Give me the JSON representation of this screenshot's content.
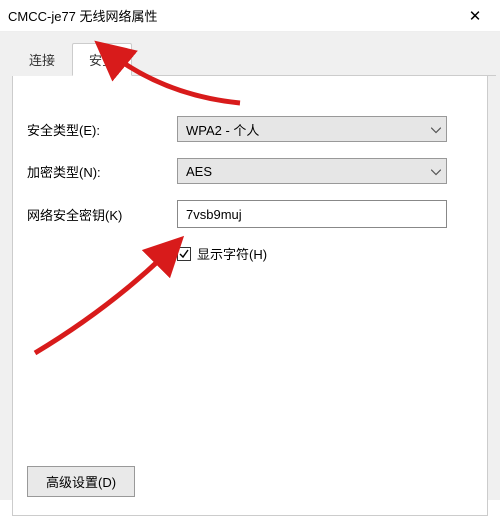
{
  "window": {
    "title": "CMCC-je77 无线网络属性",
    "close_symbol": "✕"
  },
  "tabs": {
    "connect": "连接",
    "security": "安全"
  },
  "form": {
    "security_type_label": "安全类型(E):",
    "security_type_value": "WPA2 - 个人",
    "encryption_label": "加密类型(N):",
    "encryption_value": "AES",
    "key_label": "网络安全密钥(K)",
    "key_value": "7vsb9muj",
    "show_chars_label": "显示字符(H)"
  },
  "buttons": {
    "advanced": "高级设置(D)"
  },
  "colors": {
    "arrow": "#d81b1b"
  }
}
